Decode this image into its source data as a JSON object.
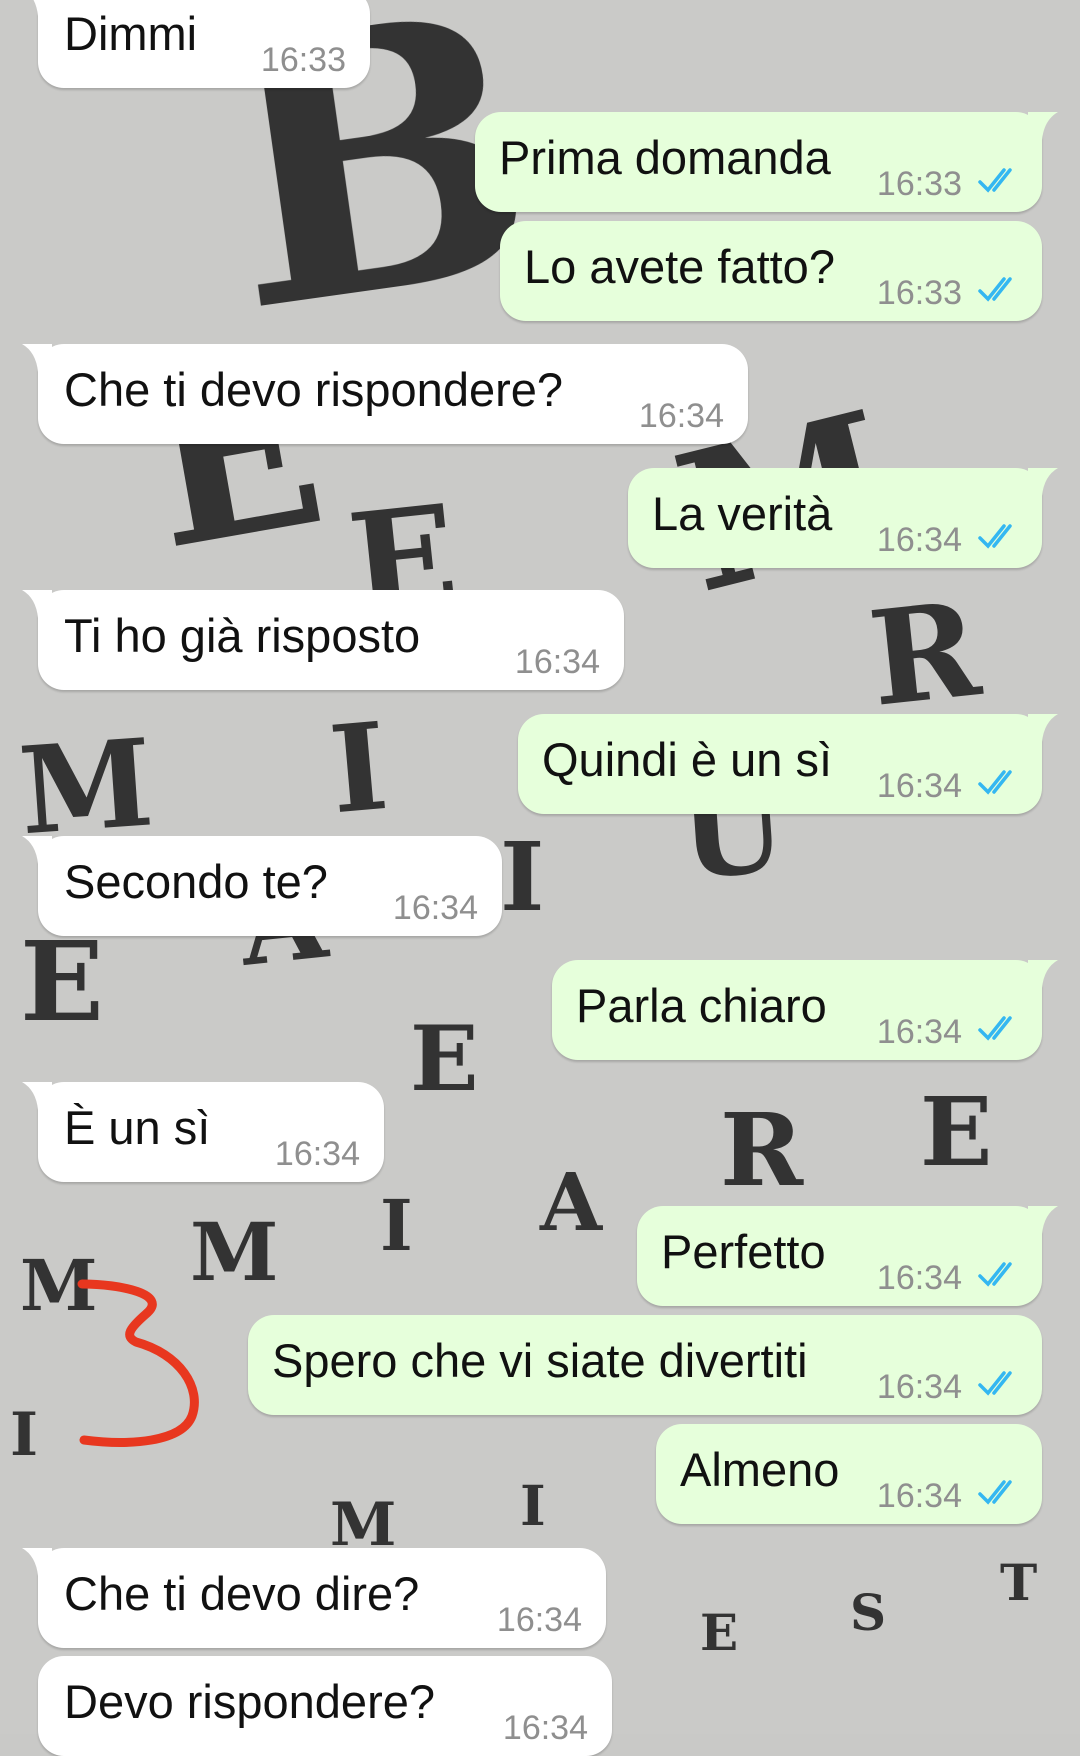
{
  "messages": [
    {
      "dir": "in",
      "text": "Dimmi",
      "time": "16:33"
    },
    {
      "dir": "out",
      "text": "Prima domanda",
      "time": "16:33",
      "status": "read-ticks-icon"
    },
    {
      "dir": "out",
      "text": "Lo avete fatto?",
      "time": "16:33",
      "status": "read-ticks-icon"
    },
    {
      "dir": "in",
      "text": "Che ti devo rispondere?",
      "time": "16:34"
    },
    {
      "dir": "out",
      "text": "La verità",
      "time": "16:34",
      "status": "read-ticks-icon"
    },
    {
      "dir": "in",
      "text": "Ti ho già risposto",
      "time": "16:34"
    },
    {
      "dir": "out",
      "text": "Quindi è un sì",
      "time": "16:34",
      "status": "read-ticks-icon"
    },
    {
      "dir": "in",
      "text": "Secondo te?",
      "time": "16:34"
    },
    {
      "dir": "out",
      "text": "Parla chiaro",
      "time": "16:34",
      "status": "read-ticks-icon"
    },
    {
      "dir": "in",
      "text": "È un sì",
      "time": "16:34"
    },
    {
      "dir": "out",
      "text": "Perfetto",
      "time": "16:34",
      "status": "read-ticks-icon"
    },
    {
      "dir": "out",
      "text": "Spero che vi siate divertiti",
      "time": "16:34",
      "status": "read-ticks-icon"
    },
    {
      "dir": "out",
      "text": "Almeno",
      "time": "16:34",
      "status": "read-ticks-icon"
    },
    {
      "dir": "in",
      "text": "Che ti devo dire?",
      "time": "16:34"
    },
    {
      "dir": "in",
      "text": "Devo rispondere?",
      "time": "16:34"
    }
  ],
  "wallpaper_letters": [
    "B",
    "E",
    "E",
    "M",
    "R",
    "I",
    "M",
    "U",
    "I",
    "A",
    "E",
    "E",
    "R",
    "E",
    "A",
    "I",
    "M",
    "M",
    "I",
    "M",
    "I",
    "E",
    "S",
    "T"
  ],
  "colors": {
    "incoming_bubble": "#ffffff",
    "outgoing_bubble": "#e6ffdb",
    "read_ticks": "#34b7f1",
    "timestamp": "#8f8f8f",
    "annotation": "#e8371f"
  }
}
